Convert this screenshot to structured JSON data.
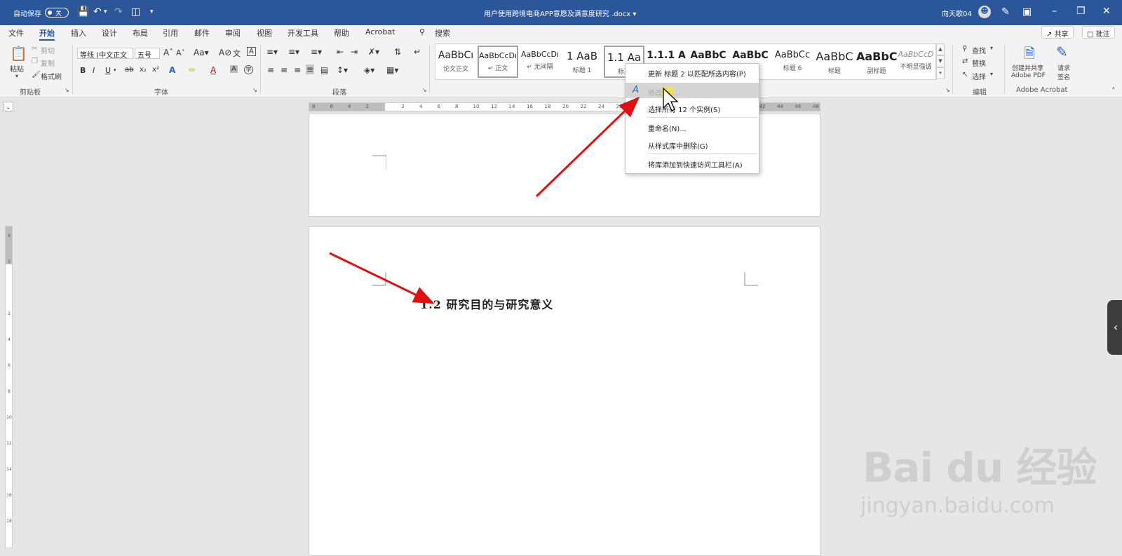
{
  "titlebar": {
    "autosave_label": "自动保存",
    "autosave_state": "关",
    "doc_title": "用户使用跨境电商APP意愿及满意度研究 .docx ▾",
    "user": "向天歌04"
  },
  "menu": {
    "tabs": [
      "文件",
      "开始",
      "插入",
      "设计",
      "布局",
      "引用",
      "邮件",
      "审阅",
      "视图",
      "开发工具",
      "帮助",
      "Acrobat"
    ],
    "active_tab": "开始",
    "search_label": "搜索",
    "share_label": "共享",
    "comment_label": "批注"
  },
  "ribbon": {
    "clipboard": {
      "paste": "粘贴",
      "cut": "剪切",
      "copy": "复制",
      "format_painter": "格式刷",
      "group": "剪贴板"
    },
    "font": {
      "font_name": "等线 (中文正文",
      "font_size": "五号",
      "group": "字体"
    },
    "paragraph": {
      "group": "段落"
    },
    "styles": [
      {
        "preview": "AaBbCı",
        "name": "论文正文"
      },
      {
        "preview": "AaBbCcDı",
        "name": "↵ 正文"
      },
      {
        "preview": "AaBbCcDı",
        "name": "↵ 无间隔"
      },
      {
        "preview": "1  AaB",
        "name": "标题 1"
      },
      {
        "preview": "1.1  Aa",
        "name": "标题"
      },
      {
        "preview": "1.1.1  A",
        "name": ""
      },
      {
        "preview": "AaBbC",
        "name": ""
      },
      {
        "preview": "AaBbC",
        "name": ""
      },
      {
        "preview": "AaBbCc",
        "name": "标题 6"
      },
      {
        "preview": "AaBbC",
        "name": "标题"
      },
      {
        "preview": "AaBbC",
        "name": "副标题"
      },
      {
        "preview": "AaBbCcD",
        "name": "不明显强调"
      }
    ],
    "editing": {
      "find": "查找",
      "replace": "替换",
      "select": "选择",
      "group": "编辑"
    },
    "acrobat": {
      "create_share": "创建并共享",
      "adobe_pdf": "Adobe PDF",
      "request": "请求",
      "sign": "签名",
      "group": "Adobe Acrobat"
    }
  },
  "ruler": {
    "marks": [
      "8",
      "6",
      "4",
      "2",
      "",
      "2",
      "4",
      "6",
      "8",
      "10",
      "12",
      "14",
      "16",
      "18",
      "20",
      "22",
      "24",
      "26",
      "",
      "",
      "",
      "",
      "",
      "",
      "",
      "42",
      "44",
      "46",
      "48"
    ]
  },
  "vruler": {
    "marks": [
      "4",
      "2",
      "",
      "2",
      "4",
      "6",
      "8",
      "10",
      "12",
      "14",
      "16",
      "18"
    ]
  },
  "context_menu": {
    "items": [
      "更新 标题 2 以匹配所选内容(P)",
      "修改(M)...",
      "选择所有 12 个实例(S)",
      "重命名(N)...",
      "从样式库中删除(G)",
      "将库添加到快速访问工具栏(A)"
    ],
    "highlighted_index": 1
  },
  "document": {
    "heading": "1.2 研究目的与研究意义"
  },
  "watermark": {
    "text": "Bai du 经验",
    "url": "jingyan.baidu.com"
  },
  "colors": {
    "title_bar": "#2b579a",
    "accent_red": "#e01010"
  }
}
